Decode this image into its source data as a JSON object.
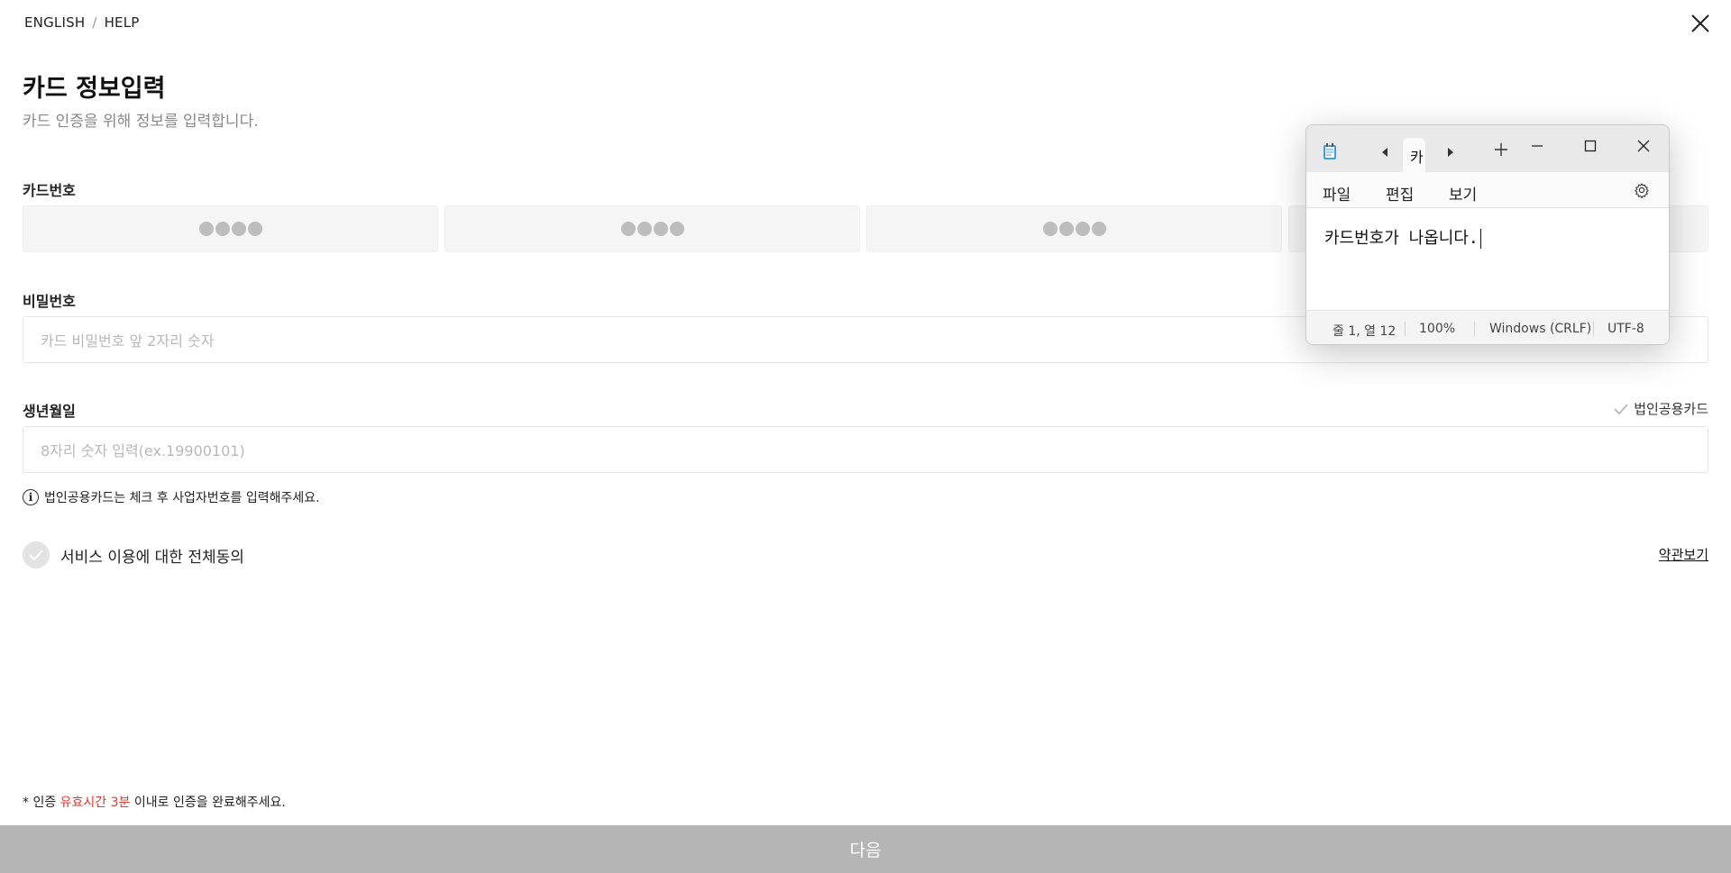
{
  "topnav": {
    "english": "ENGLISH",
    "separator": "/",
    "help": "HELP"
  },
  "page": {
    "title": "카드 정보입력",
    "subtitle": "카드 인증을 위해 정보를 입력합니다."
  },
  "card_number": {
    "label": "카드번호",
    "segments": [
      "●●●●",
      "●●●●",
      "●●●●",
      "●●●●"
    ]
  },
  "password": {
    "label": "비밀번호",
    "placeholder": "카드 비밀번호 앞 2자리 숫자"
  },
  "birth": {
    "label": "생년월일",
    "placeholder": "8자리 숫자 입력(ex.19900101)",
    "corp_card_label": "법인공용카드"
  },
  "info_note": "법인공용카드는 체크 후 사업자번호를 입력해주세요.",
  "agree": {
    "label": "서비스 이용에 대한 전체동의",
    "terms_link": "약관보기"
  },
  "footer": {
    "prefix": "* 인증 ",
    "highlight": "유효시간 3분",
    "suffix": " 이내로 인증을 완료해주세요.",
    "highlight_color": "#e8352e"
  },
  "next_button": "다음",
  "notepad": {
    "tab_title": "카",
    "menu": {
      "file": "파일",
      "edit": "편집",
      "view": "보기"
    },
    "content": "카드번호가 나옵니다.",
    "status": {
      "position": "줄 1, 열 12",
      "zoom": "100%",
      "line_ending": "Windows (CRLF)",
      "encoding": "UTF-8"
    }
  },
  "colors": {
    "next_bar": "#b5b5b5",
    "card_box": "#f5f5f5",
    "dot": "#bdbdbd"
  }
}
